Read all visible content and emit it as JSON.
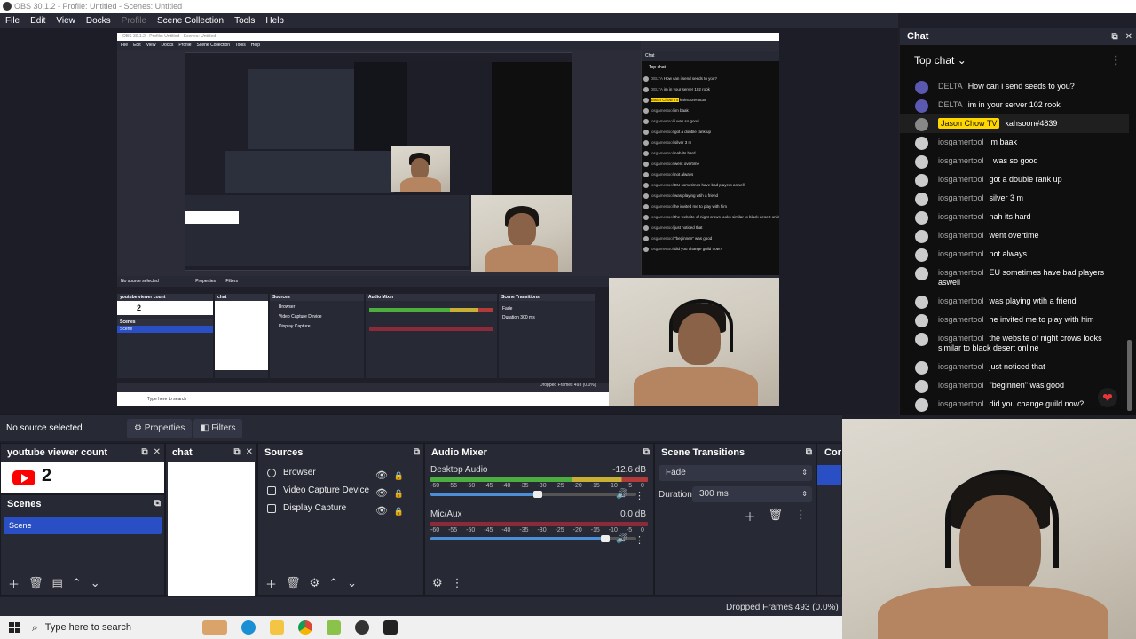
{
  "window": {
    "title": "OBS 30.1.2 - Profile: Untitled - Scenes: Untitled"
  },
  "menu": [
    "File",
    "Edit",
    "View",
    "Docks",
    "Profile",
    "Scene Collection",
    "Tools",
    "Help"
  ],
  "nested_window_title": "OBS 30.1.2 - Profile: Untitled - Scenes: Untitled",
  "preview_labels": {
    "no_source": "No source selected",
    "properties": "Properties",
    "filters": "Filters",
    "dropped": "Dropped Frames 493 (0.0%)",
    "search": "Type here to search"
  },
  "status_mid": {
    "no_source": "No source selected",
    "properties": "Properties",
    "filters": "Filters"
  },
  "docks": {
    "yt": {
      "title": "youtube viewer count",
      "count": "2"
    },
    "chat": {
      "title": "chat"
    },
    "scenes": {
      "title": "Scenes",
      "items": [
        "Scene"
      ]
    },
    "sources": {
      "title": "Sources",
      "items": [
        "Browser",
        "Video Capture Device",
        "Display Capture"
      ]
    },
    "mixer": {
      "title": "Audio Mixer",
      "channels": [
        {
          "name": "Desktop Audio",
          "db": "-12.6 dB",
          "level": 0.88,
          "volume": 0.52
        },
        {
          "name": "Mic/Aux",
          "db": "0.0 dB",
          "level": 0.0,
          "volume": 0.85
        }
      ],
      "scale": [
        "-60",
        "-55",
        "-50",
        "-45",
        "-40",
        "-35",
        "-30",
        "-25",
        "-20",
        "-15",
        "-10",
        "-5",
        "0"
      ]
    },
    "transitions": {
      "title": "Scene Transitions",
      "type": "Fade",
      "duration_label": "Duration",
      "duration": "300 ms"
    },
    "controls": {
      "title": "Cont"
    }
  },
  "status_bottom": {
    "dropped": "Dropped Frames 493 (0.0%)"
  },
  "taskbar": {
    "search": "Type here to search"
  },
  "chat": {
    "title": "Chat",
    "mode": "Top chat",
    "messages": [
      {
        "author": "DELTA",
        "text": "How can i send seeds to you?",
        "type": "delta"
      },
      {
        "author": "DELTA",
        "text": "im in your server 102 rook",
        "type": "delta"
      },
      {
        "author": "Jason Chow TV",
        "text": "kahsoon#4839",
        "type": "jason"
      },
      {
        "author": "iosgamertool",
        "text": "im baak",
        "type": "user"
      },
      {
        "author": "iosgamertool",
        "text": "i was so good",
        "type": "user"
      },
      {
        "author": "iosgamertool",
        "text": "got a double rank up",
        "type": "user"
      },
      {
        "author": "iosgamertool",
        "text": "silver 3 m",
        "type": "user"
      },
      {
        "author": "iosgamertool",
        "text": "nah its hard",
        "type": "user"
      },
      {
        "author": "iosgamertool",
        "text": "went overtime",
        "type": "user"
      },
      {
        "author": "iosgamertool",
        "text": "not always",
        "type": "user"
      },
      {
        "author": "iosgamertool",
        "text": "EU sometimes have bad players aswell",
        "type": "user"
      },
      {
        "author": "iosgamertool",
        "text": "was playing wtih a friend",
        "type": "user"
      },
      {
        "author": "iosgamertool",
        "text": "he invited me to play with him",
        "type": "user"
      },
      {
        "author": "iosgamertool",
        "text": "the website of night crows looks similar to black desert online",
        "type": "user"
      },
      {
        "author": "iosgamertool",
        "text": "just noticed that",
        "type": "user"
      },
      {
        "author": "iosgamertool",
        "text": "\"beginnen\" was good",
        "type": "user"
      },
      {
        "author": "iosgamertool",
        "text": "did you change guild now?",
        "type": "user"
      }
    ]
  },
  "colors": {
    "accent": "#2a4fc4",
    "dock_bg": "#272935",
    "chat_badge": "#ffd600",
    "youtube_red": "#ff0000"
  }
}
